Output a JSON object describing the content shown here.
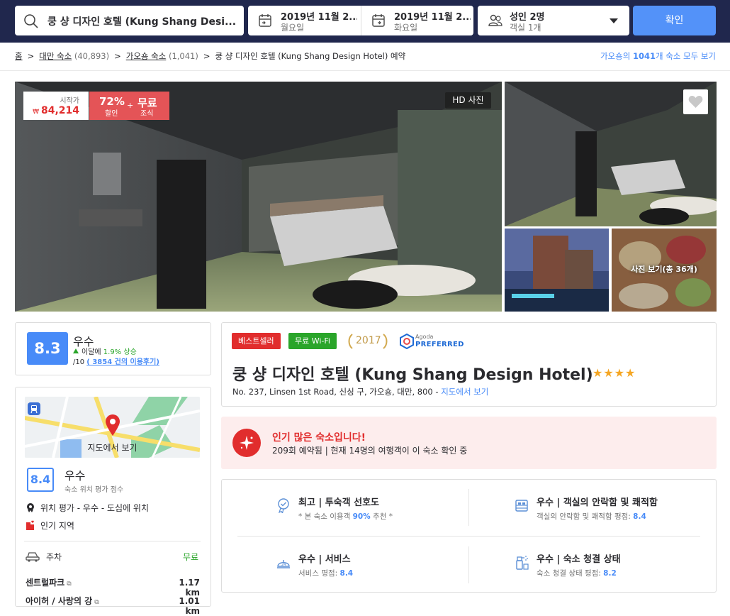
{
  "search": {
    "query": "쿵 샹 디자인 호텔 (Kung Shang Desi...",
    "checkin_date": "2019년 11월 2...",
    "checkin_day": "월요일",
    "checkout_date": "2019년 11월 2...",
    "checkout_day": "화요일",
    "guests": "성인 2명",
    "rooms": "객실 1개",
    "confirm_label": "확인"
  },
  "breadcrumb": {
    "home": "홈",
    "country": "대만 숙소",
    "country_count": "(40,893)",
    "city": "가오숑 숙소",
    "city_count": "(1,041)",
    "current": "쿵 샹 디자인 호텔 (Kung Shang Design Hotel) 예약",
    "see_all_prefix": "가오숑의 ",
    "see_all_count": "1041",
    "see_all_suffix": "개 숙소 모두 보기"
  },
  "gallery": {
    "price_label": "시작가",
    "price_currency": "₩",
    "price_value": "84,214",
    "discount_pct": "72%",
    "discount_label": "할인",
    "plus": "+",
    "free_label": "무료",
    "breakfast_label": "조식",
    "hd_label": "HD 사진",
    "more_photos": "사진 보기(총 36개)"
  },
  "review": {
    "score": "8.3",
    "label": "우수",
    "trend_prefix": "이달에 ",
    "trend_value": "1.9% 상승",
    "per": "/10",
    "reviews_link": "( 3854 건의 이용후기)"
  },
  "location": {
    "map_label": "지도에서 보기",
    "score": "8.4",
    "label": "우수",
    "sub": "숙소 위치 평가 점수",
    "line1": "위치 평가 - 우수 - 도심에 위치",
    "line2": "인기 지역",
    "parking_label": "주차",
    "parking_value": "무료",
    "pois": [
      {
        "name": "센트럴파크",
        "dist": "1.17 km"
      },
      {
        "name": "아이허 / 사랑의 강",
        "dist": "1.01 km"
      }
    ]
  },
  "hotel": {
    "badge_best": "베스트셀러",
    "badge_wifi": "무료 Wi-Fi",
    "award_year": "2017",
    "agoda_small": "Agoda",
    "agoda_preferred": "PREFERRED",
    "name": "쿵 샹 디자인 호텔 (Kung Shang Design Hotel)",
    "stars": "★★★★",
    "address": "No. 237, Linsen 1st Road, 신싱 구, 가오숑, 대만, 800 - ",
    "map_link": "지도에서 보기"
  },
  "popular": {
    "title": "인기 많은 숙소입니다!",
    "sub": "209회 예약됨 | 현재 14명의 여행객이 이 숙소 확인 중"
  },
  "features": [
    {
      "title": "최고 | 투숙객 선호도",
      "sub_prefix": "* 본 숙소 이용객 ",
      "sub_value": "90%",
      "sub_suffix": " 추천 *"
    },
    {
      "title": "우수 | 객실의 안락함 및 쾌적함",
      "sub_prefix": "객실의 안락함 및 쾌적함 평점: ",
      "sub_value": "8.4",
      "sub_suffix": ""
    },
    {
      "title": "우수 | 서비스",
      "sub_prefix": "서비스 평점: ",
      "sub_value": "8.4",
      "sub_suffix": ""
    },
    {
      "title": "우수 | 숙소 청결 상태",
      "sub_prefix": "숙소 청결 상태 평점: ",
      "sub_value": "8.2",
      "sub_suffix": ""
    }
  ],
  "colors": {
    "header": "#20274d",
    "accent": "#488bf8",
    "danger": "#e12d2d",
    "success": "#2aa52a"
  }
}
